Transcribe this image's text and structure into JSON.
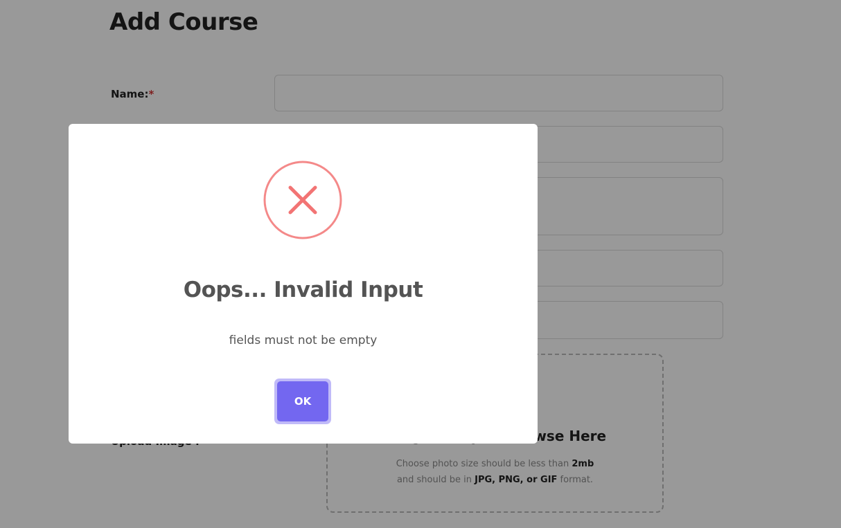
{
  "page": {
    "title": "Add Course"
  },
  "form": {
    "name_label": "Name:",
    "required_mark": "*",
    "upload_label": "Upload Image :",
    "upload": {
      "heading": "Drag & Drop or Browse Here",
      "hint_line1_prefix": "Choose photo size should be less than ",
      "hint_size": "2mb",
      "hint_line2_prefix": "and should be in ",
      "hint_formats": "JPG, PNG, or GIF",
      "hint_line2_suffix": " format."
    }
  },
  "dialog": {
    "icon": "error-x-icon",
    "title": "Oops... Invalid Input",
    "message": "fields must not be empty",
    "ok_label": "OK"
  },
  "colors": {
    "error_icon": "#f27474",
    "confirm_button": "#7367f0",
    "overlay": "#000000"
  }
}
